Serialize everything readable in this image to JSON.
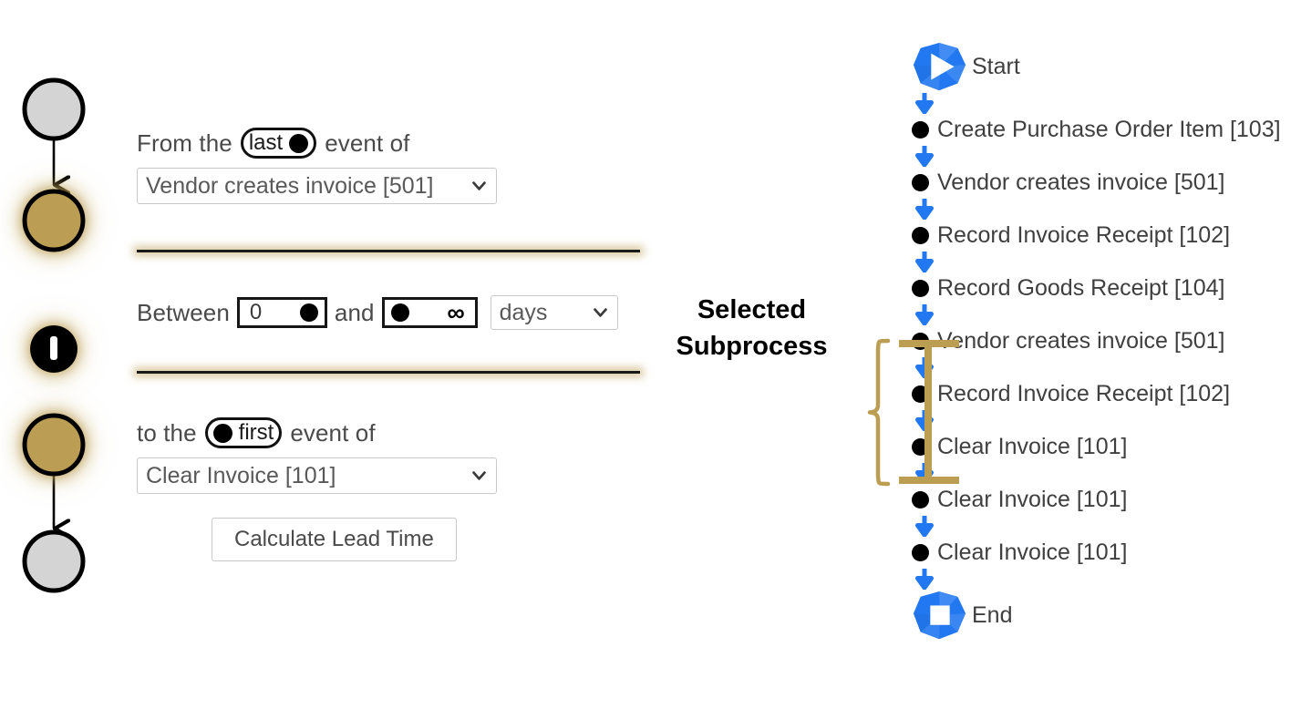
{
  "colors": {
    "gold": "#bb9e52",
    "blue": "#2278f0",
    "black": "#000000",
    "place_gray": "#d4d4d4",
    "text_gray": "#3f3f3f",
    "border_gray": "#c9c9c9"
  },
  "form": {
    "from_prefix": "From the",
    "from_toggle_label": "last",
    "from_toggle_position": "right",
    "from_suffix": "event of",
    "from_select_value": "Vendor creates invoice [501]",
    "between_label": "Between",
    "min_value": "0",
    "and_label": "and",
    "max_value": "∞",
    "unit_value": "days",
    "to_prefix": "to the",
    "to_toggle_label": "first",
    "to_toggle_position": "left",
    "to_suffix": "event of",
    "to_select_value": "Clear Invoice [101]",
    "calculate_button": "Calculate Lead Time"
  },
  "caption": {
    "line1": "Selected",
    "line2": "Subprocess"
  },
  "sequence": {
    "start_label": "Start",
    "end_label": "End",
    "start_icon": "start-polygon-play-icon",
    "end_icon": "end-polygon-square-icon",
    "arrow_icon": "arrow-down-icon",
    "events": [
      {
        "label": "Create Purchase Order Item [103]",
        "highlighted": false
      },
      {
        "label": "Vendor creates invoice [501]",
        "highlighted": false
      },
      {
        "label": "Record Invoice Receipt [102]",
        "highlighted": false
      },
      {
        "label": "Record Goods Receipt [104]",
        "highlighted": false
      },
      {
        "label": "Vendor creates invoice [501]",
        "highlighted": true
      },
      {
        "label": "Record Invoice Receipt [102]",
        "highlighted": true
      },
      {
        "label": "Clear Invoice [101]",
        "highlighted": true
      },
      {
        "label": "Clear Invoice [101]",
        "highlighted": false
      },
      {
        "label": "Clear Invoice [101]",
        "highlighted": false
      }
    ]
  },
  "petri": {
    "nodes": [
      {
        "type": "place",
        "state": "idle"
      },
      {
        "type": "place",
        "state": "selected"
      },
      {
        "type": "transition",
        "state": "selected"
      },
      {
        "type": "place",
        "state": "selected"
      },
      {
        "type": "place",
        "state": "idle"
      }
    ]
  }
}
